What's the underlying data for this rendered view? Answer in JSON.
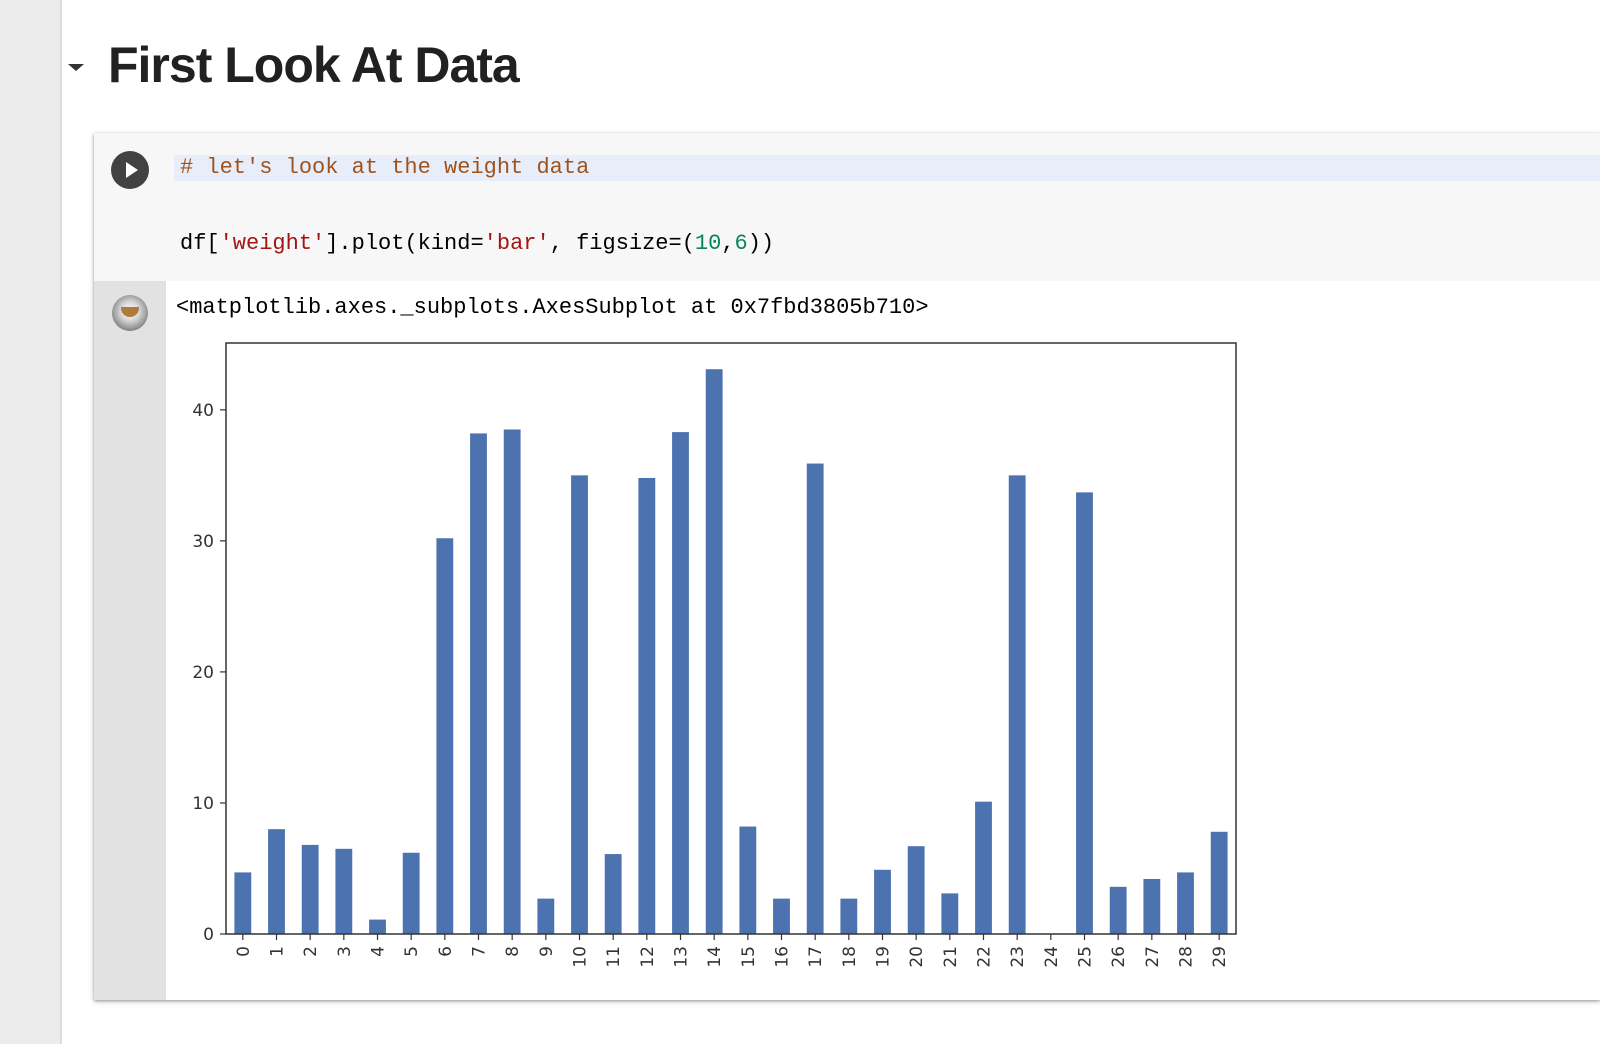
{
  "section": {
    "title": "First Look At Data"
  },
  "cell": {
    "code_comment": "# let's look at the weight data",
    "code_parts": {
      "p1": "df[",
      "s1": "'weight'",
      "p2": "].plot(kind=",
      "s2": "'bar'",
      "p3": ", figsize=(",
      "n1": "10",
      "p4": ",",
      "n2": "6",
      "p5": "))"
    },
    "output_text": "<matplotlib.axes._subplots.AxesSubplot at 0x7fbd3805b710>"
  },
  "chart_data": {
    "type": "bar",
    "title": "",
    "xlabel": "",
    "ylabel": "",
    "categories": [
      "0",
      "1",
      "2",
      "3",
      "4",
      "5",
      "6",
      "7",
      "8",
      "9",
      "10",
      "11",
      "12",
      "13",
      "14",
      "15",
      "16",
      "17",
      "18",
      "19",
      "20",
      "21",
      "22",
      "23",
      "24",
      "25",
      "26",
      "27",
      "28",
      "29"
    ],
    "values": [
      4.7,
      8.0,
      6.8,
      6.5,
      1.1,
      6.2,
      30.2,
      38.2,
      38.5,
      2.7,
      35.0,
      6.1,
      34.8,
      38.3,
      43.1,
      8.2,
      2.7,
      35.9,
      2.7,
      4.9,
      6.7,
      3.1,
      10.1,
      35.0,
      0,
      33.7,
      3.6,
      4.2,
      4.7,
      7.8
    ],
    "ylim": [
      0,
      45.1
    ],
    "yticks": [
      0,
      10,
      20,
      30,
      40
    ],
    "bar_color": "#4c72b0",
    "grid": false,
    "legend": false
  }
}
